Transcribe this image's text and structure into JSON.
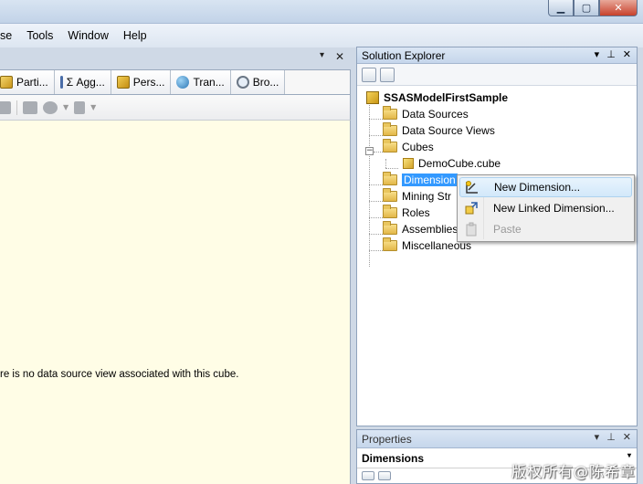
{
  "menu": [
    "se",
    "Tools",
    "Window",
    "Help"
  ],
  "window_controls": {
    "minimize": "▁",
    "maximize": "▢",
    "close": "✕"
  },
  "doc_header": {
    "pin": "▾",
    "close": "✕"
  },
  "designer_tabs": [
    {
      "label": "Parti...",
      "icon": "partition-icon"
    },
    {
      "label": "Σ Agg...",
      "icon": "aggregation-icon"
    },
    {
      "label": "Pers...",
      "icon": "perspective-icon"
    },
    {
      "label": "Tran...",
      "icon": "translation-icon"
    },
    {
      "label": "Bro...",
      "icon": "browser-icon"
    }
  ],
  "canvas_message": "re is no data source view associated with this cube.",
  "solution_explorer": {
    "title": "Solution Explorer",
    "controls": {
      "dropdown": "▾",
      "pin": "⊥",
      "close": "✕"
    },
    "project": "SSASModelFirstSample",
    "items": {
      "data_sources": "Data Sources",
      "data_source_views": "Data Source Views",
      "cubes": "Cubes",
      "demo_cube": "DemoCube.cube",
      "dimensions": "Dimension",
      "mining_structures": "Mining Str",
      "roles": "Roles",
      "assemblies": "Assemblies",
      "miscellaneous": "Miscellaneous"
    }
  },
  "context_menu": {
    "new_dimension": "New Dimension...",
    "new_linked_dimension": "New Linked Dimension...",
    "paste": "Paste"
  },
  "properties": {
    "title": "Properties",
    "controls": {
      "dropdown": "▾",
      "pin": "⊥",
      "close": "✕"
    },
    "object": "Dimensions",
    "object_dropdown": "▾"
  },
  "watermark": "版权所有@陈希章"
}
